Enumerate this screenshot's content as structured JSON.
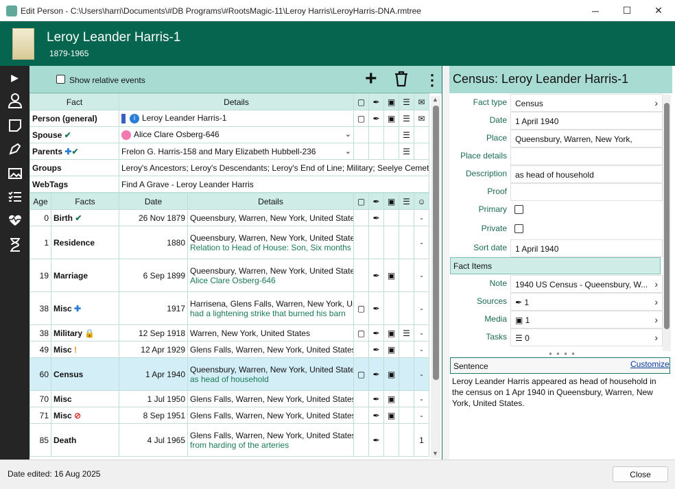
{
  "window": {
    "title": "Edit Person - C:\\Users\\harri\\Documents\\#DB Programs\\#RootsMagic-11\\Leroy Harris\\LeroyHarris-DNA.rmtree",
    "minimize": "─",
    "maximize": "☐",
    "close": "✕"
  },
  "person": {
    "name": "Leroy Leander Harris-1",
    "dates": "1879-1965"
  },
  "toolbar": {
    "show_relative_events": "Show relative events",
    "add": "+",
    "delete": "🗑",
    "more": "⋮"
  },
  "top_table": {
    "headers": [
      "Fact",
      "Details"
    ],
    "rows": [
      {
        "fact": "Person (general)",
        "details": "Leroy Leander Harris-1"
      },
      {
        "fact": "Spouse",
        "details": "Alice Clare Osberg-646"
      },
      {
        "fact": "Parents",
        "details": "Frelon G. Harris-158 and Mary Elizabeth Hubbell-236"
      },
      {
        "fact": "Groups",
        "details": "Leroy's Ancestors; Leroy's Descendants; Leroy's End of Line; Military; Seelye Cemetery"
      },
      {
        "fact": "WebTags",
        "details": "Find A Grave - Leroy Leander Harris"
      }
    ]
  },
  "facts_table": {
    "headers": [
      "Age",
      "Facts",
      "Date",
      "Details"
    ],
    "rows": [
      {
        "age": "0",
        "fact": "Birth",
        "date": "26 Nov 1879",
        "line1": "Queensbury, Warren, New York, United States",
        "line2": "",
        "last": "-"
      },
      {
        "age": "1",
        "fact": "Residence",
        "date": "1880",
        "line1": "Queensbury, Warren, New York, United States",
        "line2": "Relation to Head of House: Son, Six months",
        "last": "-"
      },
      {
        "age": "19",
        "fact": "Marriage",
        "date": "6 Sep 1899",
        "line1": "Queensbury, Warren, New York, United States",
        "line2": "Alice Clare Osberg-646",
        "last": "-"
      },
      {
        "age": "38",
        "fact": "Misc",
        "date": "1917",
        "line1": "Harrisena, Glens Falls, Warren, New York, United States",
        "line2": "had a  lightening strike that burned his barn",
        "last": "-"
      },
      {
        "age": "38",
        "fact": "Military",
        "date": "12 Sep 1918",
        "line1": "Warren, New York, United States",
        "line2": "",
        "last": "-"
      },
      {
        "age": "49",
        "fact": "Misc",
        "date": "12 Apr 1929",
        "line1": "Glens Falls, Warren, New York, United States",
        "line2": "",
        "last": "-"
      },
      {
        "age": "60",
        "fact": "Census",
        "date": "1 Apr 1940",
        "line1": "Queensbury, Warren, New York, United States",
        "line2": "as head of household",
        "last": "-"
      },
      {
        "age": "70",
        "fact": "Misc",
        "date": "1 Jul 1950",
        "line1": "Glens Falls, Warren, New York, United States",
        "line2": "",
        "last": "-"
      },
      {
        "age": "71",
        "fact": "Misc",
        "date": "8 Sep 1951",
        "line1": "Glens Falls, Warren, New York, United States",
        "line2": "",
        "last": "-"
      },
      {
        "age": "85",
        "fact": "Death",
        "date": "4 Jul 1965",
        "line1": "Glens Falls, Warren, New York, United States",
        "line2": "from harding of the arteries",
        "last": "1"
      }
    ]
  },
  "right_panel": {
    "title": "Census: Leroy Leander Harris-1",
    "fields": [
      {
        "label": "Fact type",
        "value": "Census"
      },
      {
        "label": "Date",
        "value": "1 April 1940"
      },
      {
        "label": "Place",
        "value": "Queensbury, Warren, New York,"
      },
      {
        "label": "Place details",
        "value": ""
      },
      {
        "label": "Description",
        "value": "as head of household"
      },
      {
        "label": "Proof",
        "value": ""
      },
      {
        "label": "Primary",
        "value": ""
      },
      {
        "label": "Private",
        "value": ""
      },
      {
        "label": "Sort date",
        "value": "1 April 1940"
      }
    ],
    "fact_items_label": "Fact Items",
    "items": [
      {
        "label": "Note",
        "value": "1940 US Census - Queensbury, W..."
      },
      {
        "label": "Sources",
        "value": "1"
      },
      {
        "label": "Media",
        "value": "1"
      },
      {
        "label": "Tasks",
        "value": "0"
      }
    ],
    "sentence_label": "Sentence",
    "customize": "Customize",
    "sentence": "Leroy Leander Harris appeared as head of household in the census on 1 Apr 1940 in Queensbury, Warren, New York, United States."
  },
  "status": {
    "date_edited": "Date edited: 16 Aug 2025",
    "close": "Close"
  },
  "colors": {
    "header": "#05654f",
    "toolbar": "#a8dcd2",
    "accent_green": "#1a7a55",
    "selected_row": "#d4eef8"
  }
}
